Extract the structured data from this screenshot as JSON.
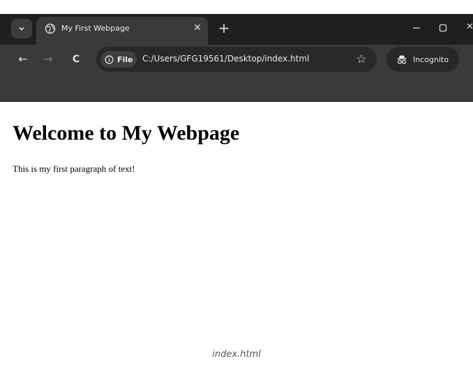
{
  "browser": {
    "tab": {
      "title": "My First Webpage",
      "favicon": "globe-icon"
    },
    "url": {
      "scheme_label": "File",
      "path": "C:/Users/GFG19561/Desktop/index.html"
    },
    "profile_label": "Incognito"
  },
  "page": {
    "heading": "Welcome to My Webpage",
    "paragraph": "This is my first paragraph of text!"
  },
  "caption": "index.html",
  "colors": {
    "tabbar_bg": "#1f1f1f",
    "toolbar_bg": "#3a3a3a",
    "omnibox_bg": "#282828",
    "page_bg": "#ffffff"
  }
}
